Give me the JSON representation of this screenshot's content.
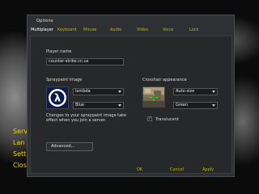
{
  "main_menu": {
    "items": [
      "Serv",
      "Lan",
      "Sett",
      "Clos"
    ]
  },
  "dialog": {
    "title": "Options",
    "tabs": [
      "Multiplayer",
      "Keyboard",
      "Mouse",
      "Audio",
      "Video",
      "Voice",
      "Lock"
    ],
    "active_tab": "Multiplayer",
    "player_name": {
      "label": "Player name",
      "value": "counter-strike.cn.us"
    },
    "spraypaint": {
      "label": "Spraypaint image",
      "image_value": "lambda",
      "color_value": "Blue",
      "note_line1": "Changes to your spraypaint image take",
      "note_line2": "effect when you join a server.",
      "logo_glyph": "λ"
    },
    "crosshair": {
      "label": "Crosshair appearance",
      "size_value": "Auto-size",
      "color_value": "Green",
      "translucent_label": "Translucent",
      "translucent_checked": "✓"
    },
    "advanced_button": "Advanced...",
    "buttons": {
      "ok": "OK",
      "cancel": "Cancel",
      "apply": "Apply"
    }
  },
  "colors": {
    "accent_yellow": "#c8b400",
    "dialog_bg": "#2e3033",
    "logo_blue": "#0a1a4a"
  }
}
